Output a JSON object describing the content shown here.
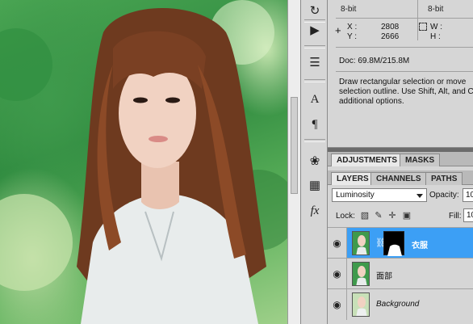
{
  "info": {
    "bit_left": "8-bit",
    "bit_right": "8-bit",
    "x_label": "X :",
    "y_label": "Y :",
    "x_value": "2808",
    "y_value": "2666",
    "w_label": "W :",
    "h_label": "H :",
    "doc": "Doc: 69.8M/215.8M",
    "description_lines": [
      "Draw rectangular selection or move",
      "selection outline.  Use Shift, Alt, and C",
      "additional options."
    ]
  },
  "tabs_top": [
    "ADJUSTMENTS",
    "MASKS"
  ],
  "tabs_layers": [
    "LAYERS",
    "CHANNELS",
    "PATHS"
  ],
  "layers_panel": {
    "blend_mode": "Luminosity",
    "opacity_label": "Opacity:",
    "opacity_value": "10",
    "lock_label": "Lock:",
    "fill_label": "Fill:",
    "fill_value": "10"
  },
  "layers": [
    {
      "name": "衣服",
      "selected": true
    },
    {
      "name": "面部",
      "selected": false
    },
    {
      "name": "Background",
      "selected": false
    }
  ],
  "tools": [
    "history-brush-icon",
    "play-action-icon",
    "swatches-list-icon",
    "type-tool-icon",
    "paragraph-icon",
    "palette-icon",
    "grid-icon",
    "fx-icon"
  ],
  "colors": {
    "selected_layer": "#3c9ff5",
    "panel_bg": "#d6d6d6"
  }
}
